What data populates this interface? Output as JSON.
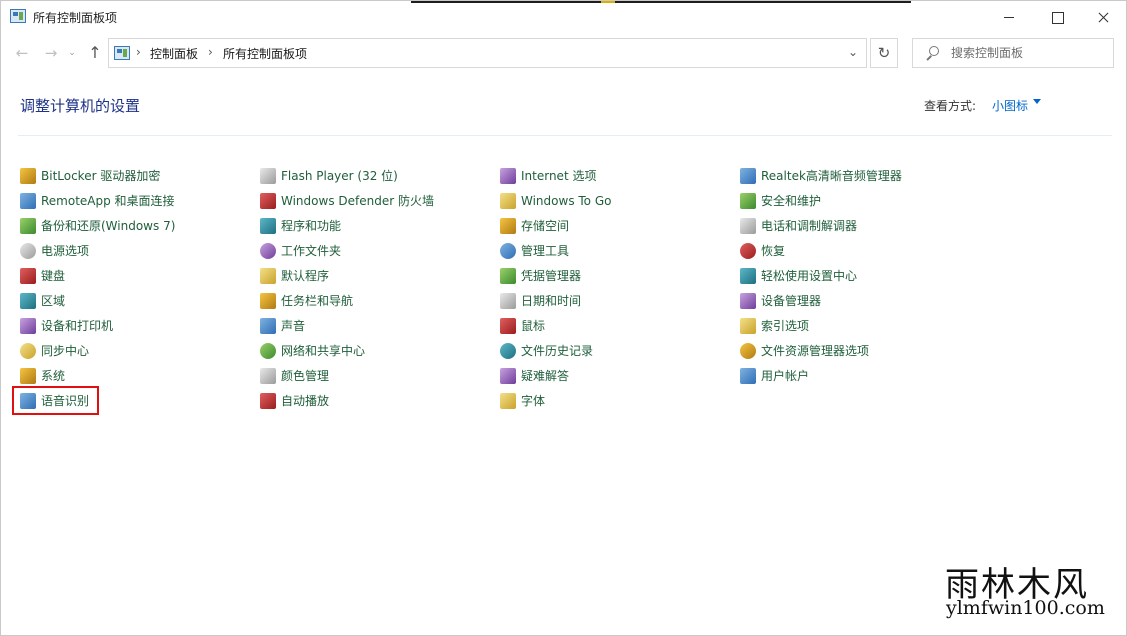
{
  "window": {
    "title": "所有控制面板项"
  },
  "address": {
    "crumbs": [
      "控制面板",
      "所有控制面板项"
    ],
    "separator": "›"
  },
  "nav": {
    "back": "←",
    "forward": "→",
    "recent": "⌄",
    "up": "↑",
    "refresh": "↻",
    "dropdown": "⌄"
  },
  "search": {
    "placeholder": "搜索控制面板"
  },
  "header": {
    "title": "调整计算机的设置",
    "view_by_label": "查看方式:",
    "view_by_value": "小图标"
  },
  "columns": [
    [
      {
        "label": "BitLocker 驱动器加密",
        "icon": "bitlocker-icon"
      },
      {
        "label": "RemoteApp 和桌面连接",
        "icon": "remoteapp-icon"
      },
      {
        "label": "备份和还原(Windows 7)",
        "icon": "backup-restore-icon"
      },
      {
        "label": "电源选项",
        "icon": "power-options-icon"
      },
      {
        "label": "键盘",
        "icon": "keyboard-icon"
      },
      {
        "label": "区域",
        "icon": "region-icon"
      },
      {
        "label": "设备和打印机",
        "icon": "devices-printers-icon"
      },
      {
        "label": "同步中心",
        "icon": "sync-center-icon"
      },
      {
        "label": "系统",
        "icon": "system-icon"
      },
      {
        "label": "语音识别",
        "icon": "speech-recognition-icon",
        "highlight": true
      }
    ],
    [
      {
        "label": "Flash Player (32 位)",
        "icon": "flash-player-icon"
      },
      {
        "label": "Windows Defender 防火墙",
        "icon": "firewall-icon"
      },
      {
        "label": "程序和功能",
        "icon": "programs-features-icon"
      },
      {
        "label": "工作文件夹",
        "icon": "work-folders-icon"
      },
      {
        "label": "默认程序",
        "icon": "default-programs-icon"
      },
      {
        "label": "任务栏和导航",
        "icon": "taskbar-navigation-icon"
      },
      {
        "label": "声音",
        "icon": "sound-icon"
      },
      {
        "label": "网络和共享中心",
        "icon": "network-sharing-icon"
      },
      {
        "label": "颜色管理",
        "icon": "color-management-icon"
      },
      {
        "label": "自动播放",
        "icon": "autoplay-icon"
      }
    ],
    [
      {
        "label": "Internet 选项",
        "icon": "internet-options-icon"
      },
      {
        "label": "Windows To Go",
        "icon": "windows-to-go-icon"
      },
      {
        "label": "存储空间",
        "icon": "storage-spaces-icon"
      },
      {
        "label": "管理工具",
        "icon": "admin-tools-icon"
      },
      {
        "label": "凭据管理器",
        "icon": "credential-manager-icon"
      },
      {
        "label": "日期和时间",
        "icon": "date-time-icon"
      },
      {
        "label": "鼠标",
        "icon": "mouse-icon"
      },
      {
        "label": "文件历史记录",
        "icon": "file-history-icon"
      },
      {
        "label": "疑难解答",
        "icon": "troubleshooting-icon"
      },
      {
        "label": "字体",
        "icon": "fonts-icon"
      }
    ],
    [
      {
        "label": "Realtek高清晰音频管理器",
        "icon": "realtek-audio-icon"
      },
      {
        "label": "安全和维护",
        "icon": "security-maintenance-icon"
      },
      {
        "label": "电话和调制解调器",
        "icon": "phone-modem-icon"
      },
      {
        "label": "恢复",
        "icon": "recovery-icon"
      },
      {
        "label": "轻松使用设置中心",
        "icon": "ease-of-access-icon"
      },
      {
        "label": "设备管理器",
        "icon": "device-manager-icon"
      },
      {
        "label": "索引选项",
        "icon": "indexing-options-icon"
      },
      {
        "label": "文件资源管理器选项",
        "icon": "explorer-options-icon"
      },
      {
        "label": "用户帐户",
        "icon": "user-accounts-icon"
      }
    ]
  ],
  "watermark": {
    "title": "雨林木风",
    "url": "ylmfwin100.com"
  }
}
